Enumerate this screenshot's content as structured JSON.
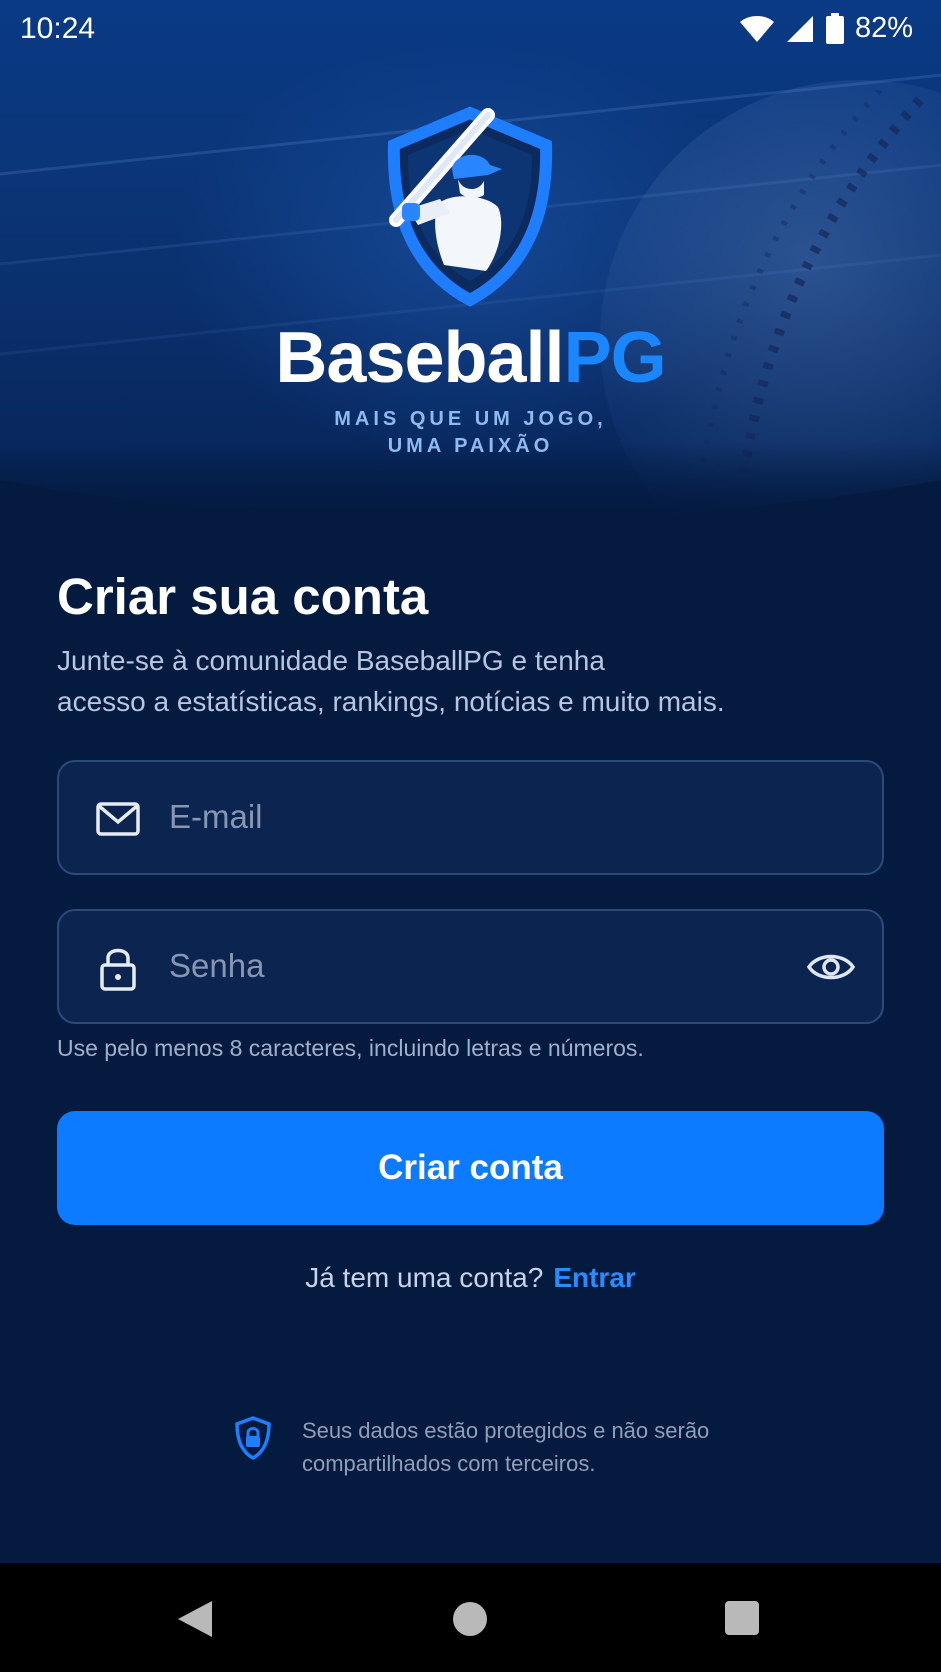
{
  "status_bar": {
    "time": "10:24",
    "battery": "82%",
    "icons": [
      "wifi-icon",
      "signal-icon",
      "battery-icon"
    ]
  },
  "brand": {
    "name_part1": "Baseball",
    "name_part2": "PG",
    "tagline_line1": "MAIS QUE UM JOGO,",
    "tagline_line2": "UMA PAIXÃO",
    "emblem_icon": "baseball-batter-shield-logo"
  },
  "form": {
    "title": "Criar sua conta",
    "subtitle_line1": "Junte-se à comunidade BaseballPG e tenha",
    "subtitle_line2": "acesso a estatísticas, rankings, notícias e muito mais.",
    "email": {
      "placeholder": "E-mail",
      "value": "",
      "icon": "mail-icon"
    },
    "password": {
      "placeholder": "Senha",
      "value": "",
      "icon": "lock-icon",
      "toggle_icon": "eye-icon"
    },
    "password_hint": "Use pelo menos 8 caracteres, incluindo letras e números.",
    "submit_label": "Criar conta",
    "signin_prompt": "Já tem uma conta?",
    "signin_link": "Entrar"
  },
  "privacy": {
    "icon": "shield-lock-icon",
    "line1": "Seus dados estão protegidos e não serão",
    "line2": "compartilhados com terceiros."
  },
  "nav_bar": {
    "buttons": [
      "back-icon",
      "home-icon",
      "recents-icon"
    ]
  },
  "colors": {
    "background": "#041a3f",
    "accent": "#0d7bff",
    "link": "#2a8bff",
    "field_border": "#2b4a78"
  }
}
